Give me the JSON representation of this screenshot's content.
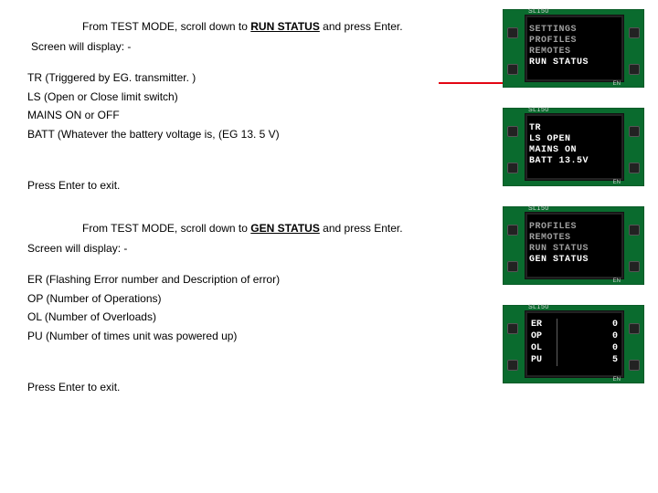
{
  "section_run": {
    "intro_prefix": "From TEST MODE, scroll down to ",
    "intro_target": "RUN STATUS",
    "intro_suffix": " and press Enter.",
    "display_line": "Screen will display: -",
    "items": [
      "TR (Triggered by EG. transmitter. )",
      "LS (Open or Close limit switch)",
      "MAINS ON or OFF",
      "BATT (Whatever the battery voltage is, (EG 13. 5 V)"
    ],
    "exit": "Press Enter to exit."
  },
  "section_gen": {
    "intro_prefix": "From TEST MODE, scroll down to ",
    "intro_target": "GEN STATUS",
    "intro_suffix": " and press Enter.",
    "display_line": "Screen will display: -",
    "items": [
      "ER (Flashing Error number and Description of error)",
      "OP (Number of Operations)",
      "OL (Number of Overloads)",
      "PU (Number of times unit was powered up)"
    ],
    "exit": "Press Enter to exit."
  },
  "thumbs": {
    "device_label": "SL150",
    "en_label": "EN",
    "screen1_lines": [
      "SETTINGS",
      "PROFILES",
      "REMOTES",
      "RUN STATUS"
    ],
    "screen1_dim_upto": 3,
    "screen2_lines": [
      "TR",
      "LS OPEN",
      "MAINS ON",
      "BATT 13.5V"
    ],
    "screen3_lines": [
      "PROFILES",
      "REMOTES",
      "RUN STATUS",
      "GEN STATUS"
    ],
    "screen3_dim_upto": 3,
    "screen4_left": [
      "ER",
      "OP",
      "OL",
      "PU"
    ],
    "screen4_right": [
      "0",
      "0",
      "0",
      "5"
    ]
  }
}
